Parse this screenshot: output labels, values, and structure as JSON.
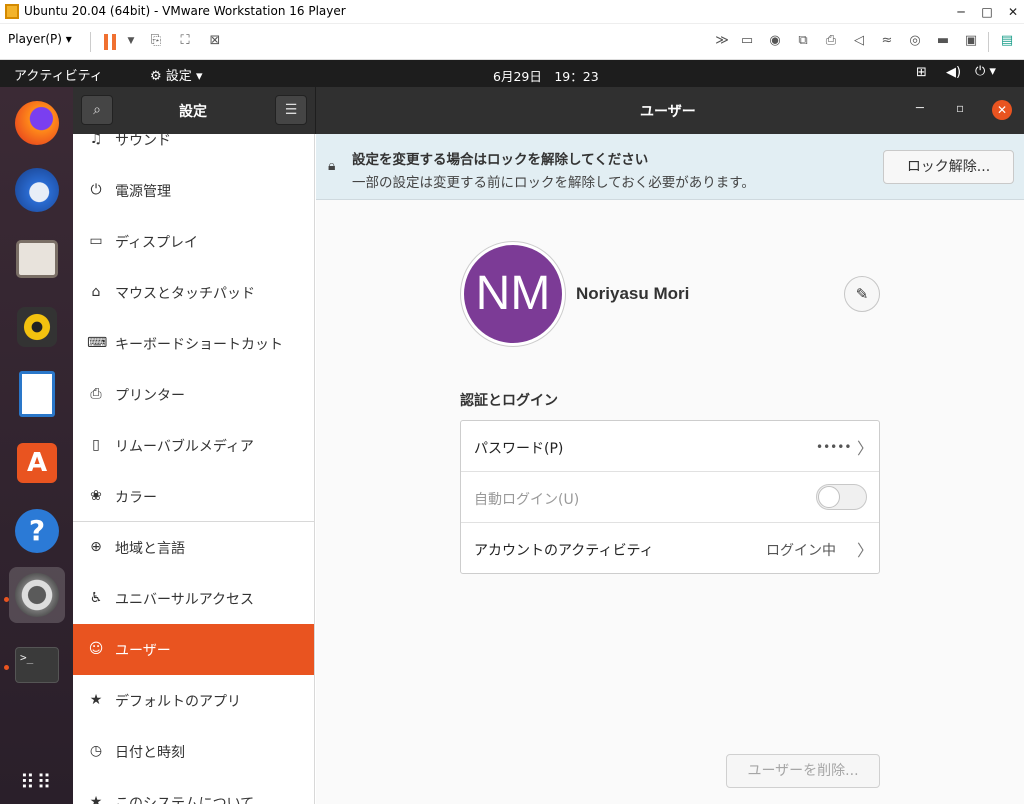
{
  "vmware": {
    "title": "Ubuntu 20.04 (64bit) - VMware Workstation 16 Player",
    "player_menu": "Player(P)",
    "controls": {
      "minimize": "─",
      "maximize": "□",
      "close": "✕"
    }
  },
  "topbar": {
    "activities": "アクティビティ",
    "app_menu": "設定",
    "clock": "6月29日　19：23"
  },
  "settings": {
    "sidebar_title": "設定",
    "page_title": "ユーザー",
    "sidebar_items": [
      {
        "label": "サウンド",
        "icon": "♫"
      },
      {
        "label": "電源管理",
        "icon": "⏻"
      },
      {
        "label": "ディスプレイ",
        "icon": "▭"
      },
      {
        "label": "マウスとタッチパッド",
        "icon": "⌂"
      },
      {
        "label": "キーボードショートカット",
        "icon": "⌨"
      },
      {
        "label": "プリンター",
        "icon": "⎙"
      },
      {
        "label": "リムーバブルメディア",
        "icon": "▯"
      },
      {
        "label": "カラー",
        "icon": "❀"
      },
      {
        "label": "地域と言語",
        "icon": "⊕"
      },
      {
        "label": "ユニバーサルアクセス",
        "icon": "♿"
      },
      {
        "label": "ユーザー",
        "icon": "☺"
      },
      {
        "label": "デフォルトのアプリ",
        "icon": "★"
      },
      {
        "label": "日付と時刻",
        "icon": "◷"
      },
      {
        "label": "このシステムについて",
        "icon": "★"
      }
    ],
    "active_item": "ユーザー"
  },
  "lock_banner": {
    "title": "設定を変更する場合はロックを解除してください",
    "subtitle": "一部の設定は変更する前にロックを解除しておく必要があります。",
    "unlock_label": "ロック解除..."
  },
  "user": {
    "initials": "NM",
    "name": "Noriyasu Mori",
    "avatar_color": "#7c3b96"
  },
  "auth": {
    "heading": "認証とログイン",
    "password_label": "パスワード(P)",
    "password_value": "•••••",
    "autologin_label": "自動ログイン(U)",
    "autologin_enabled": false,
    "activity_label": "アカウントのアクティビティ",
    "activity_value": "ログイン中"
  },
  "delete_user_label": "ユーザーを削除..."
}
